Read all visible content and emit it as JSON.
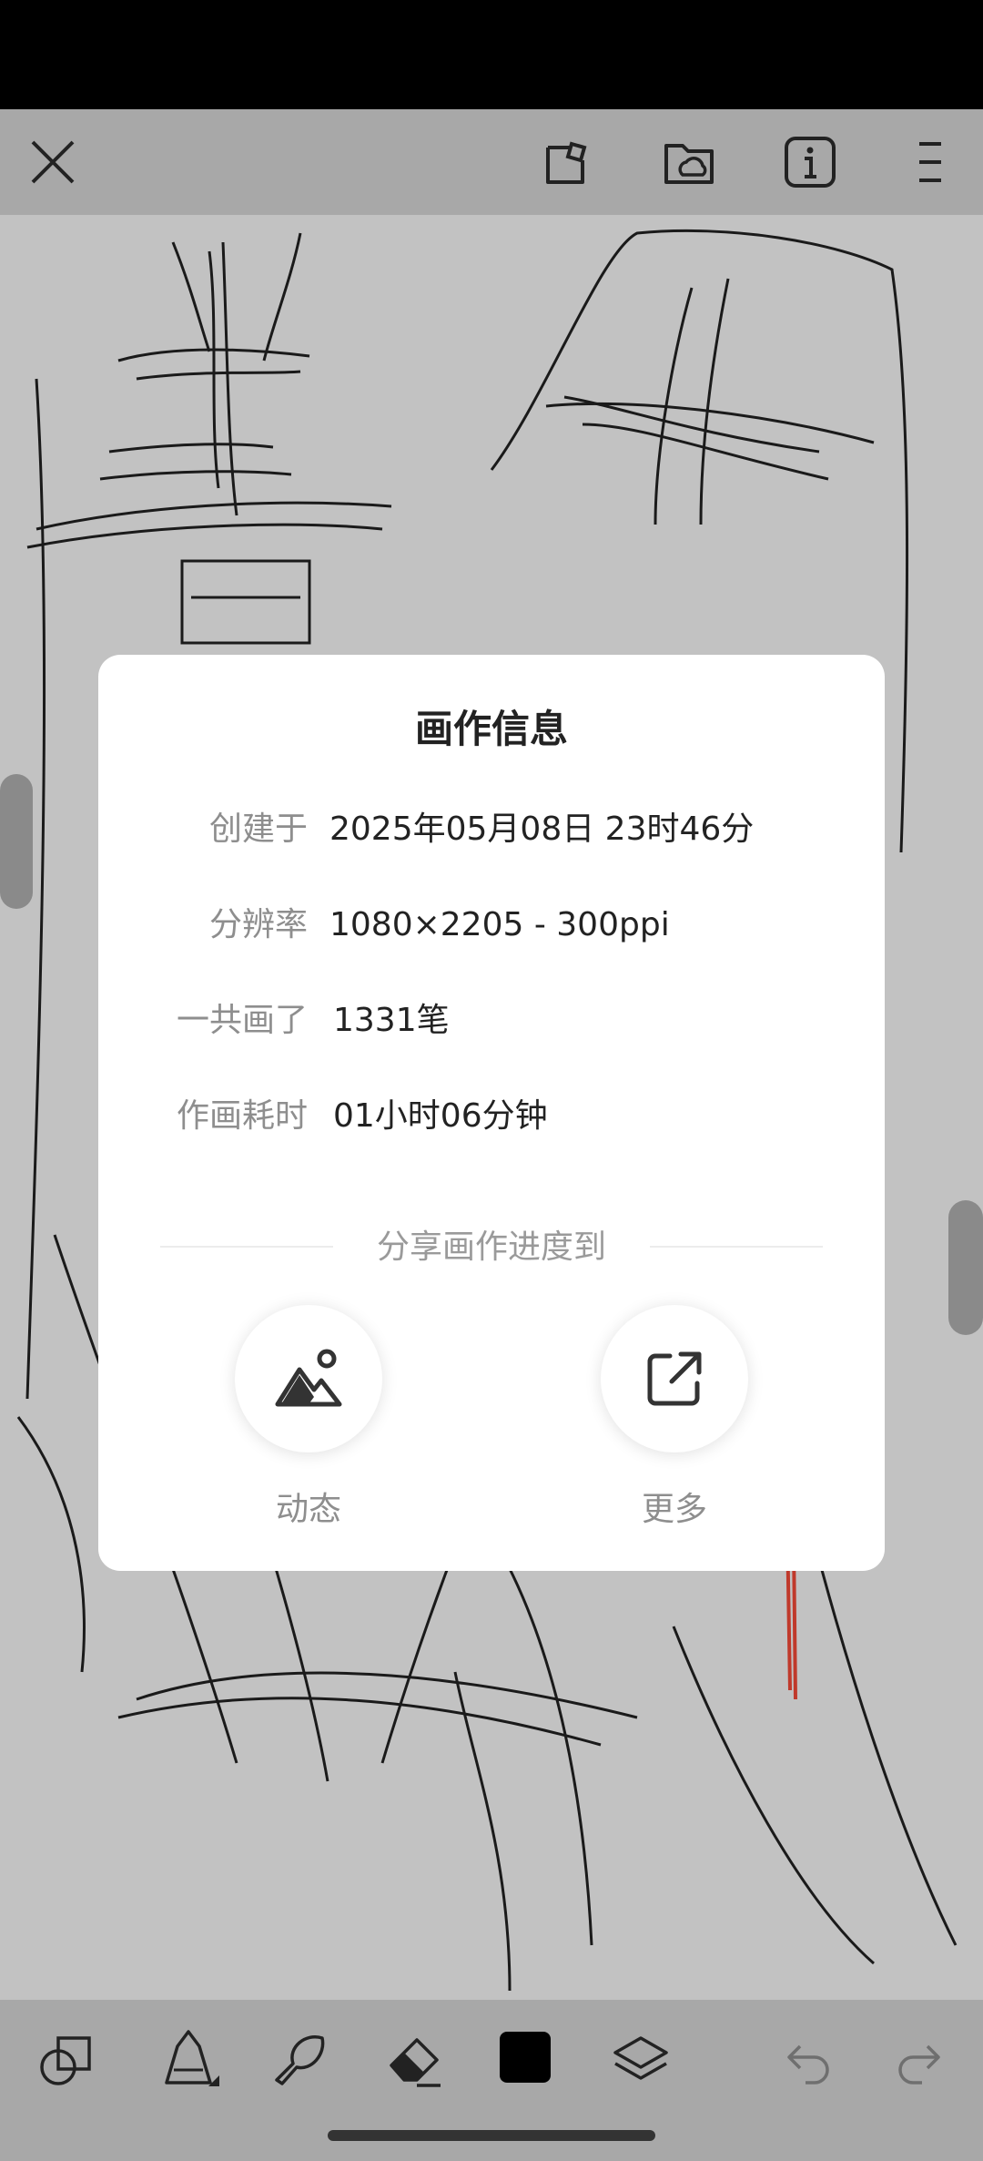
{
  "toolbar": {
    "close_icon": "close-icon",
    "icons": [
      "new-canvas-icon",
      "folder-cloud-icon",
      "info-icon",
      "menu-icon"
    ]
  },
  "dialog": {
    "title": "画作信息",
    "rows": [
      {
        "label": "创建于",
        "value": "2025年05月08日 23时46分"
      },
      {
        "label": "分辨率",
        "value": "1080×2205 - 300ppi"
      },
      {
        "label": "一共画了",
        "value": "1331笔"
      },
      {
        "label": "作画耗时",
        "value": "01小时06分钟"
      }
    ],
    "share_title": "分享画作进度到",
    "share_options": [
      {
        "label": "动态",
        "icon": "image-mountain-icon"
      },
      {
        "label": "更多",
        "icon": "external-share-icon"
      }
    ]
  },
  "bottom_toolbar": {
    "tools": [
      "shapes-icon",
      "pencil-icon",
      "smudge-icon",
      "eraser-icon",
      "color-swatch",
      "layers-icon",
      "undo-icon",
      "redo-icon"
    ],
    "current_color": "#000000"
  }
}
